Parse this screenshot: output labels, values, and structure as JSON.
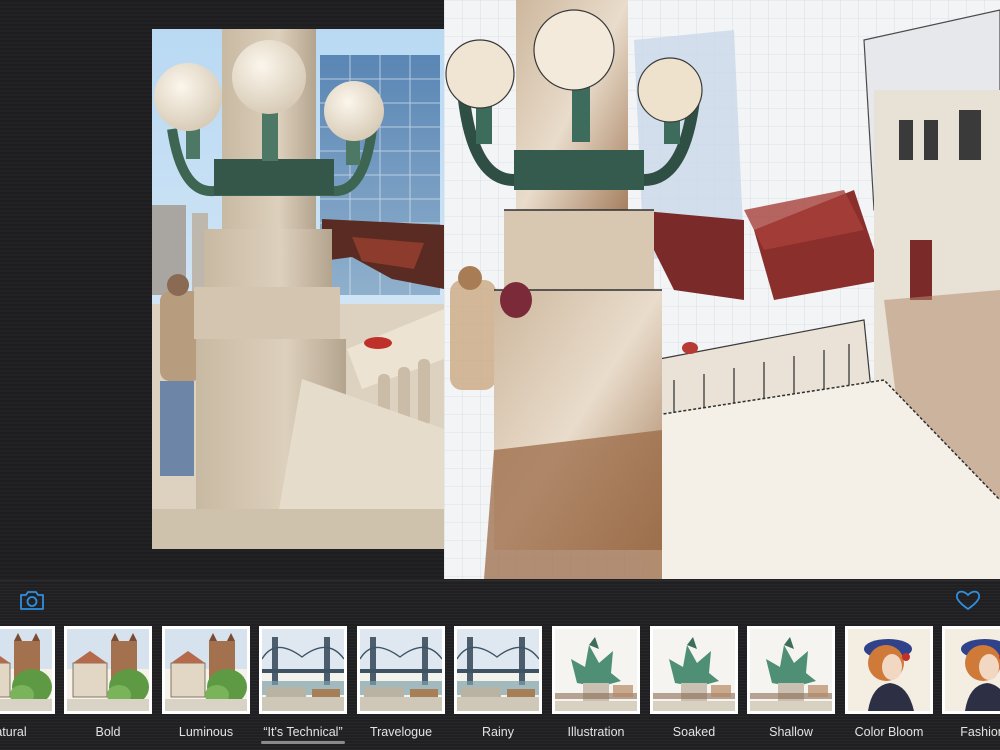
{
  "toolbar": {
    "camera_icon": "camera-icon",
    "favorite_icon": "heart-outline-icon",
    "accent_color": "#2f8fe0"
  },
  "presets": [
    {
      "label": "Natural",
      "display": "atural",
      "scene": "castle",
      "selected": false
    },
    {
      "label": "Bold",
      "display": "Bold",
      "scene": "castle",
      "selected": false
    },
    {
      "label": "Luminous",
      "display": "Luminous",
      "scene": "castle",
      "selected": false
    },
    {
      "label": "“It's Technical”",
      "display": "“It's Technical”",
      "scene": "bridge",
      "selected": true
    },
    {
      "label": "Travelogue",
      "display": "Travelogue",
      "scene": "bridge",
      "selected": false
    },
    {
      "label": "Rainy",
      "display": "Rainy",
      "scene": "bridge",
      "selected": false
    },
    {
      "label": "Illustration",
      "display": "Illustration",
      "scene": "dragon",
      "selected": false
    },
    {
      "label": "Soaked",
      "display": "Soaked",
      "scene": "dragon",
      "selected": false
    },
    {
      "label": "Shallow",
      "display": "Shallow",
      "scene": "dragon",
      "selected": false
    },
    {
      "label": "Color Bloom",
      "display": "Color Bloom",
      "scene": "portrait",
      "selected": false
    },
    {
      "label": "Fashionable",
      "display": "Fashiona",
      "scene": "portrait",
      "selected": false
    }
  ]
}
